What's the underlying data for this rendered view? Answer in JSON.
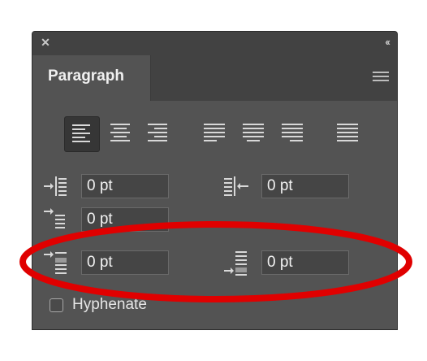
{
  "window": {
    "close_glyph": "✕",
    "collapse_glyph": "‹‹"
  },
  "tab": {
    "label": "Paragraph"
  },
  "indents": {
    "left_indent": "0 pt",
    "right_indent": "0 pt",
    "first_line_indent": "0 pt",
    "space_before": "0 pt",
    "space_after": "0 pt"
  },
  "hyphenate": {
    "label": "Hyphenate",
    "checked": false
  },
  "alignment": {
    "selected": "align-left"
  },
  "annotation": {
    "color": "#e00000"
  }
}
